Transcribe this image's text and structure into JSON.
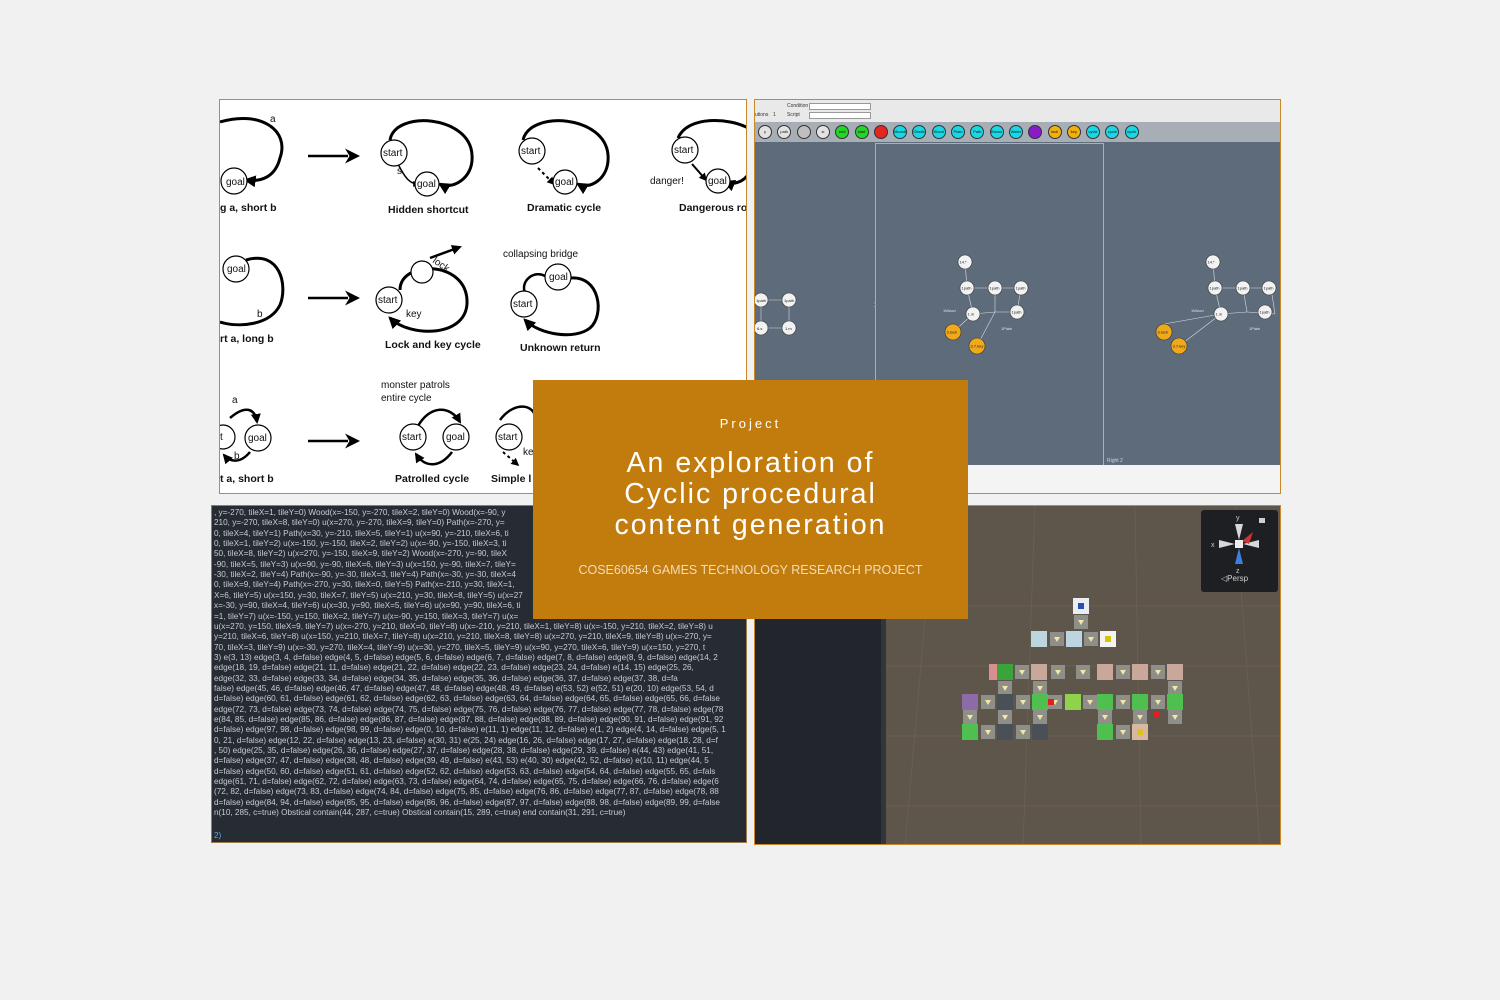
{
  "title_card": {
    "kicker": "Project",
    "title_lines": [
      "An exploration of",
      "Cyclic procedural",
      "content generation"
    ],
    "subtitle": "COSE60654  GAMES TECHNOLOGY RESEARCH PROJECT"
  },
  "diagrams": {
    "row1": [
      {
        "caption": "g a, short b",
        "nodes": [
          "goal"
        ],
        "edge_label": "a"
      },
      {
        "caption": "Hidden shortcut",
        "nodes": [
          "start",
          "goal"
        ],
        "edge_label": "s"
      },
      {
        "caption": "Dramatic cycle",
        "nodes": [
          "start",
          "goal"
        ]
      },
      {
        "caption": "Dangerous ro",
        "nodes": [
          "start",
          "goal"
        ],
        "note": "danger!"
      }
    ],
    "row2": [
      {
        "caption": "rt a, long b",
        "nodes": [
          "goal"
        ],
        "edge_label": "b"
      },
      {
        "caption": "Lock and key cycle",
        "nodes": [
          "start"
        ],
        "labels": [
          "lock",
          "key"
        ]
      },
      {
        "caption": "Unknown return",
        "nodes": [
          "goal",
          "start"
        ],
        "note": "collapsing bridge"
      }
    ],
    "row3": [
      {
        "caption": "t a, short b",
        "nodes": [
          "t",
          "goal"
        ],
        "labels": [
          "a",
          "b"
        ]
      },
      {
        "caption": "Patrolled cycle",
        "nodes": [
          "start",
          "goal"
        ],
        "note_lines": [
          "monster patrols",
          "entire cycle"
        ]
      },
      {
        "caption": "Simple l",
        "nodes": [
          "start"
        ],
        "edge_label": "ke"
      }
    ]
  },
  "editor": {
    "field_labels": [
      "Condition",
      "Script",
      "utions"
    ],
    "field_value": "1",
    "tools": [
      {
        "label": "y",
        "color": "#e3e3e3"
      },
      {
        "label": "path",
        "color": "#e3e3e3"
      },
      {
        "label": "",
        "color": "#bfbfbf"
      },
      {
        "label": "si",
        "color": "#e3e3e3"
      },
      {
        "label": "end",
        "color": "#25d426"
      },
      {
        "label": "start",
        "color": "#25d426"
      },
      {
        "label": "",
        "color": "#e82323"
      },
      {
        "label": "Monster",
        "color": "#19d8e6"
      },
      {
        "label": "Obstical",
        "color": "#19d8e6"
      },
      {
        "label": "Wood",
        "color": "#19d8e6"
      },
      {
        "label": "Plain",
        "color": "#19d8e6"
      },
      {
        "label": "Path",
        "color": "#19d8e6"
      },
      {
        "label": "Boxes",
        "color": "#19d8e6"
      },
      {
        "label": "Water",
        "color": "#19d8e6"
      },
      {
        "label": "",
        "color": "#8a1ac9"
      },
      {
        "label": "lock",
        "color": "#f1b10d"
      },
      {
        "label": "key",
        "color": "#f1b10d"
      },
      {
        "label": "cycle",
        "color": "#19d8e6"
      },
      {
        "label": "cycle",
        "color": "#19d8e6"
      },
      {
        "label": "cycle",
        "color": "#19d8e6"
      }
    ],
    "sheet_label": "Right 2",
    "node_labels": [
      "14.*",
      "1path",
      "1path",
      "1path",
      "3.lock",
      "1.m",
      "1path",
      "3.7.key",
      "1Plain",
      "1Wood"
    ],
    "left_nodes": [
      "1path",
      "1path",
      "6.s",
      "1.m"
    ]
  },
  "console": {
    "lines": [
      ", y=-270, tileX=1, tileY=0) Wood(x=-150, y=-270, tileX=2, tileY=0) Wood(x=-90, y",
      "210, y=-270, tileX=8, tileY=0) u(x=270, y=-270, tileX=9, tileY=0) Path(x=-270, y=",
      "0, tileX=4, tileY=1) Path(x=30, y=-210, tileX=5, tileY=1) u(x=90, y=-210, tileX=6, ti",
      "0, tileX=1, tileY=2) u(x=-150, y=-150, tileX=2, tileY=2) u(x=-90, y=-150, tileX=3, ti",
      "50, tileX=8, tileY=2) u(x=270, y=-150, tileX=9, tileY=2) Wood(x=-270, y=-90, tileX",
      "-90, tileX=5, tileY=3) u(x=90, y=-90, tileX=6, tileY=3) u(x=150, y=-90, tileX=7, tileY=",
      "-30, tileX=2, tileY=4) Path(x=-90, y=-30, tileX=3, tileY=4) Path(x=-30, y=-30, tileX=4",
      "0, tileX=9, tileY=4) Path(x=-270, y=30, tileX=0, tileY=5) Path(x=-210, y=30, tileX=1,",
      "X=6, tileY=5) u(x=150, y=30, tileX=7, tileY=5) u(x=210, y=30, tileX=8, tileY=5) u(x=27",
      "x=-30, y=90, tileX=4, tileY=6) u(x=30, y=90, tileX=5, tileY=6) u(x=90, y=90, tileX=6, ti",
      "=1, tileY=7) u(x=-150, y=150, tileX=2, tileY=7) u(x=-90, y=150, tileX=3, tileY=7) u(x=",
      "u(x=270, y=150, tileX=9, tileY=7) u(x=-270, y=210, tileX=0, tileY=8) u(x=-210, y=210, tileX=1, tileY=8) u(x=-150, y=210, tileX=2, tileY=8) u",
      "y=210, tileX=6, tileY=8) u(x=150, y=210, tileX=7, tileY=8) u(x=210, y=210, tileX=8, tileY=8) u(x=270, y=210, tileX=9, tileY=8) u(x=-270, y=",
      "70, tileX=3, tileY=9) u(x=-30, y=270, tileX=4, tileY=9) u(x=30, y=270, tileX=5, tileY=9) u(x=90, y=270, tileX=6, tileY=9) u(x=150, y=270, t",
      "3) e(3, 13) edge(3, 4, d=false) edge(4, 5, d=false) edge(5, 6, d=false) edge(6, 7, d=false) edge(7, 8, d=false) edge(8, 9, d=false) edge(14, 2",
      "edge(18, 19, d=false) edge(21, 11, d=false) edge(21, 22, d=false) edge(22, 23, d=false) edge(23, 24, d=false) e(14, 15) edge(25, 26,",
      "edge(32, 33, d=false) edge(33, 34, d=false) edge(34, 35, d=false) edge(35, 36, d=false) edge(36, 37, d=false) edge(37, 38, d=fa",
      "false) edge(45, 46, d=false) edge(46, 47, d=false) edge(47, 48, d=false) edge(48, 49, d=false) e(53, 52) e(52, 51) e(20, 10) edge(53, 54, d",
      "d=false) edge(60, 61, d=false) edge(61, 62, d=false) edge(62, 63, d=false) edge(63, 64, d=false) edge(64, 65, d=false) edge(65, 66, d=false",
      "edge(72, 73, d=false) edge(73, 74, d=false) edge(74, 75, d=false) edge(75, 76, d=false) edge(76, 77, d=false) edge(77, 78, d=false) edge(78",
      "e(84, 85, d=false) edge(85, 86, d=false) edge(86, 87, d=false) edge(87, 88, d=false) edge(88, 89, d=false) edge(90, 91, d=false) edge(91, 92",
      "d=false) edge(97, 98, d=false) edge(98, 99, d=false) edge(0, 10, d=false) e(11, 1) edge(11, 12, d=false) e(1, 2) edge(4, 14, d=false) edge(5, 1",
      "0, 21, d=false) edge(12, 22, d=false) edge(13, 23, d=false) e(30, 31) e(25, 24) edge(16, 26, d=false) edge(17, 27, d=false) edge(18, 28, d=f",
      ", 50) edge(25, 35, d=false) edge(26, 36, d=false) edge(27, 37, d=false) edge(28, 38, d=false) edge(29, 39, d=false) e(44, 43) edge(41, 51,",
      "d=false) edge(37, 47, d=false) edge(38, 48, d=false) edge(39, 49, d=false) e(43, 53) e(40, 30) edge(42, 52, d=false) e(10, 11) edge(44, 5",
      "d=false) edge(50, 60, d=false) edge(51, 61, d=false) edge(52, 62, d=false) edge(53, 63, d=false) edge(54, 64, d=false) edge(55, 65, d=fals",
      "edge(61, 71, d=false) edge(62, 72, d=false) edge(63, 73, d=false) edge(64, 74, d=false) edge(65, 75, d=false) edge(66, 76, d=false) edge(6",
      "(72, 82, d=false) edge(73, 83, d=false) edge(74, 84, d=false) edge(75, 85, d=false) edge(76, 86, d=false) edge(77, 87, d=false) edge(78, 88",
      "d=false) edge(84, 94, d=false) edge(85, 95, d=false) edge(86, 96, d=false) edge(87, 97, d=false) edge(88, 98, d=false) edge(89, 99, d=false",
      "n(10, 285, c=true) Obstical contain(44, 287, c=true) Obstical contain(15, 289, c=true) end contain(31, 291, c=true)"
    ],
    "end_marker": "2)"
  },
  "scene": {
    "gizmo": {
      "x_label": "x",
      "y_label": "y",
      "z_label": "z",
      "view_label": "Persp"
    }
  }
}
